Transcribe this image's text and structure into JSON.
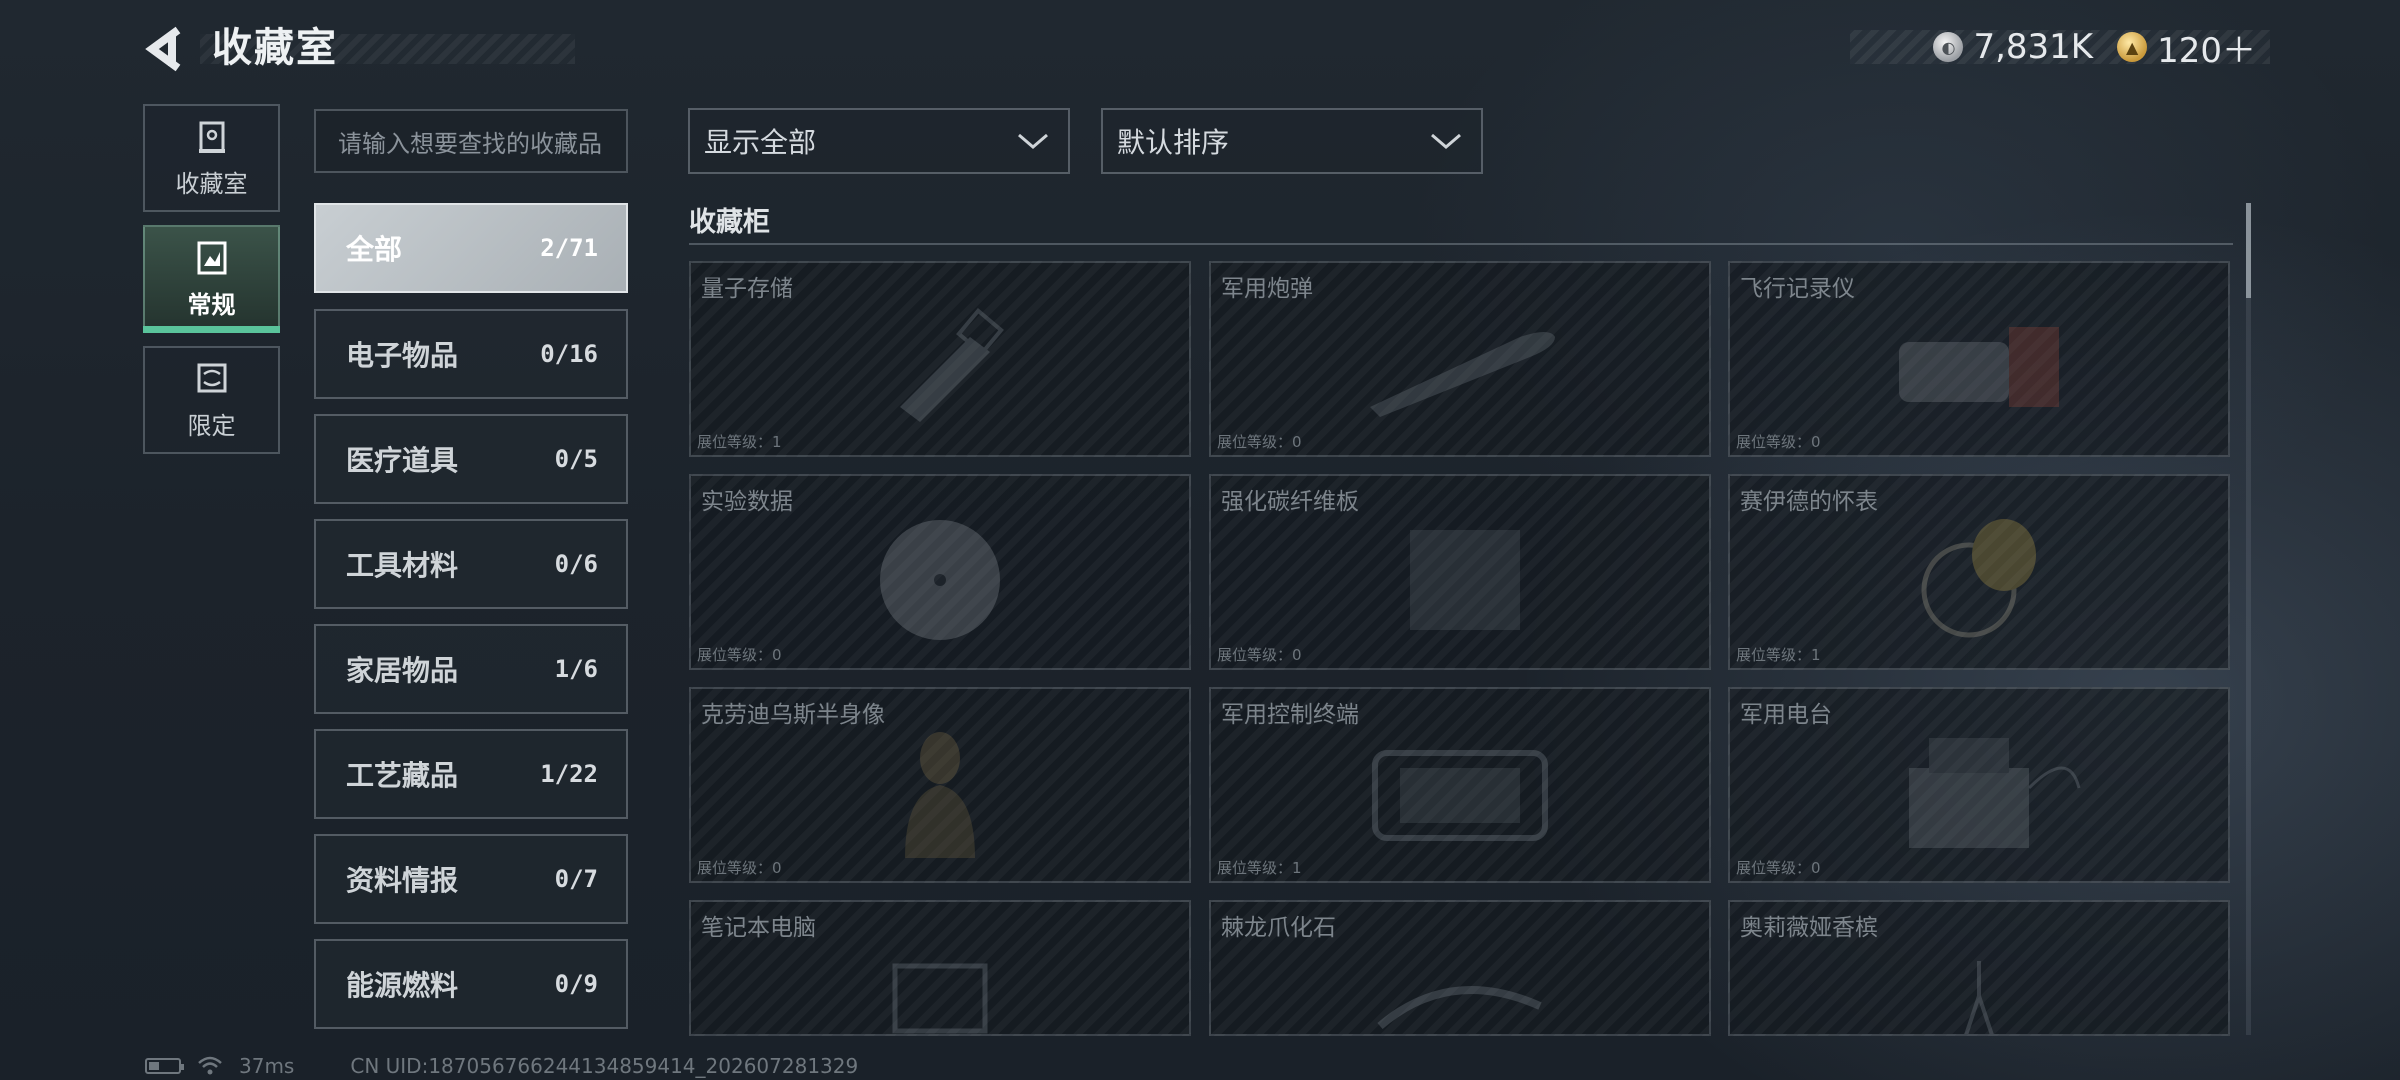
{
  "header": {
    "title": "收藏室",
    "currencies": [
      {
        "icon": "silver-coin-icon",
        "value": "7,831K"
      },
      {
        "icon": "gold-coin-icon",
        "value": "120＋"
      }
    ]
  },
  "nav": [
    {
      "label": "收藏室",
      "icon": "collection-room-icon",
      "active": false
    },
    {
      "label": "常规",
      "icon": "regular-icon",
      "active": true
    },
    {
      "label": "限定",
      "icon": "limited-icon",
      "active": false
    }
  ],
  "search": {
    "placeholder": "请输入想要查找的收藏品"
  },
  "categories": [
    {
      "label": "全部",
      "count": "2/71",
      "active": true
    },
    {
      "label": "电子物品",
      "count": "0/16"
    },
    {
      "label": "医疗道具",
      "count": "0/5"
    },
    {
      "label": "工具材料",
      "count": "0/6"
    },
    {
      "label": "家居物品",
      "count": "1/6"
    },
    {
      "label": "工艺藏品",
      "count": "1/22"
    },
    {
      "label": "资料情报",
      "count": "0/7"
    },
    {
      "label": "能源燃料",
      "count": "0/9"
    }
  ],
  "filters": {
    "display": "显示全部",
    "sort": "默认排序"
  },
  "section_title": "收藏柜",
  "level_label": "展位等级：",
  "items": [
    {
      "name": "量子存储",
      "level": "1",
      "icon": "usb-drive-icon"
    },
    {
      "name": "军用炮弹",
      "level": "0",
      "icon": "shell-icon"
    },
    {
      "name": "飞行记录仪",
      "level": "0",
      "icon": "flight-recorder-icon"
    },
    {
      "name": "实验数据",
      "level": "0",
      "icon": "disc-icon"
    },
    {
      "name": "强化碳纤维板",
      "level": "0",
      "icon": "carbon-plate-icon"
    },
    {
      "name": "赛伊德的怀表",
      "level": "1",
      "icon": "pocket-watch-icon"
    },
    {
      "name": "克劳迪乌斯半身像",
      "level": "0",
      "icon": "bust-icon"
    },
    {
      "name": "军用控制终端",
      "level": "1",
      "icon": "control-terminal-icon"
    },
    {
      "name": "军用电台",
      "level": "0",
      "icon": "radio-icon"
    },
    {
      "name": "笔记本电脑",
      "level": "",
      "icon": "laptop-icon"
    },
    {
      "name": "棘龙爪化石",
      "level": "",
      "icon": "fossil-icon"
    },
    {
      "name": "奥莉薇娅香槟",
      "level": "",
      "icon": "champagne-icon"
    }
  ],
  "footer": {
    "ping": "37ms",
    "uid": "CN UID:187056766244134859414_202607281329"
  },
  "colors": {
    "accent_green": "#5ac49b",
    "background": "#1e252d"
  }
}
